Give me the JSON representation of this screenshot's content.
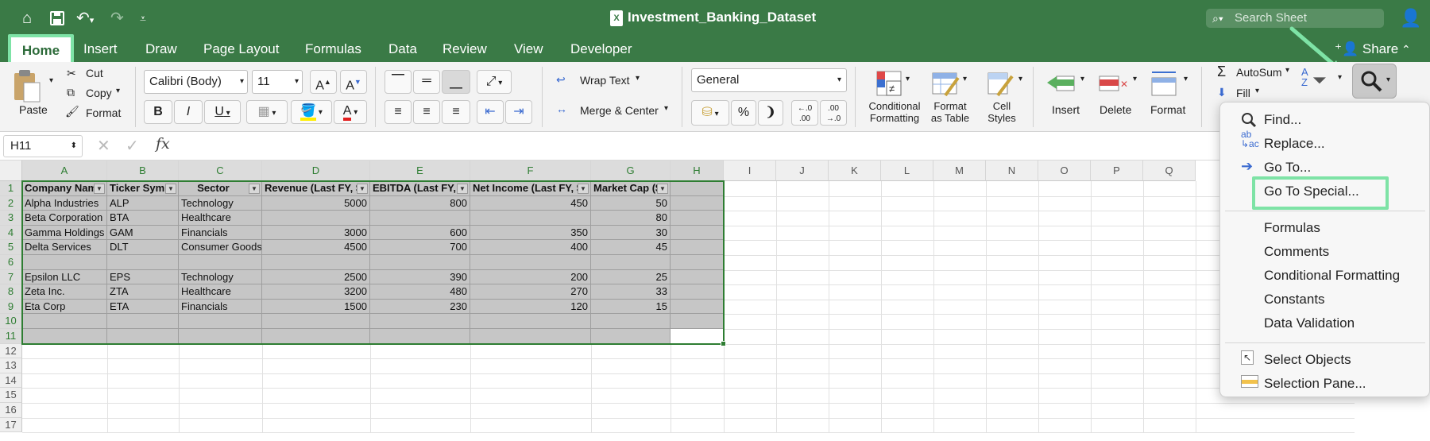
{
  "window": {
    "title": "Investment_Banking_Dataset",
    "search_placeholder": "Search Sheet"
  },
  "tabs": [
    "Home",
    "Insert",
    "Draw",
    "Page Layout",
    "Formulas",
    "Data",
    "Review",
    "View",
    "Developer"
  ],
  "share_label": "Share",
  "ribbon": {
    "paste": "Paste",
    "cut": "Cut",
    "copy": "Copy",
    "format_painter": "Format",
    "font_name": "Calibri (Body)",
    "font_size": "11",
    "bold": "B",
    "italic": "I",
    "underline": "U",
    "wrap_text": "Wrap Text",
    "merge_center": "Merge & Center",
    "number_format": "General",
    "percent": "%",
    "comma": "❩",
    "inc_decimal": "←.0\n.00",
    "dec_decimal": ".00\n→.0",
    "conditional_formatting": [
      "Conditional",
      "Formatting"
    ],
    "format_as_table": [
      "Format",
      "as Table"
    ],
    "cell_styles": [
      "Cell",
      "Styles"
    ],
    "insert": "Insert",
    "delete": "Delete",
    "format": "Format",
    "autosum": "AutoSum",
    "fill": "Fill"
  },
  "formula_bar": {
    "name_box": "H11",
    "fx": "fx",
    "formula": ""
  },
  "grid": {
    "columns": [
      "A",
      "B",
      "C",
      "D",
      "E",
      "F",
      "G",
      "H",
      "I",
      "J",
      "K",
      "L",
      "M",
      "N",
      "O",
      "P",
      "Q"
    ],
    "rows": [
      "1",
      "2",
      "3",
      "4",
      "5",
      "6",
      "7",
      "8",
      "9",
      "10",
      "11",
      "12",
      "13",
      "14",
      "15",
      "16",
      "17"
    ],
    "headers": [
      "Company Nam",
      "Ticker Symb",
      "Sector",
      "Revenue (Last FY, $i",
      "EBITDA (Last FY, $I",
      "Net Income (Last FY, $I",
      "Market Cap ($"
    ],
    "data": [
      [
        "Alpha Industries",
        "ALP",
        "Technology",
        "5000",
        "800",
        "450",
        "50"
      ],
      [
        "Beta Corporation",
        "BTA",
        "Healthcare",
        "",
        "",
        "",
        "80"
      ],
      [
        "Gamma Holdings",
        "GAM",
        "Financials",
        "3000",
        "600",
        "350",
        "30"
      ],
      [
        "Delta Services",
        "DLT",
        "Consumer Goods",
        "4500",
        "700",
        "400",
        "45"
      ],
      [
        "",
        "",
        "",
        "",
        "",
        "",
        ""
      ],
      [
        "Epsilon LLC",
        "EPS",
        "Technology",
        "2500",
        "390",
        "200",
        "25"
      ],
      [
        "Zeta Inc.",
        "ZTA",
        "Healthcare",
        "3200",
        "480",
        "270",
        "33"
      ],
      [
        "Eta Corp",
        "ETA",
        "Financials",
        "1500",
        "230",
        "120",
        "15"
      ]
    ]
  },
  "find_menu": {
    "items": [
      "Find...",
      "Replace...",
      "Go To...",
      "Go To Special...",
      "Formulas",
      "Comments",
      "Conditional Formatting",
      "Constants",
      "Data Validation",
      "Select Objects",
      "Selection Pane..."
    ]
  }
}
